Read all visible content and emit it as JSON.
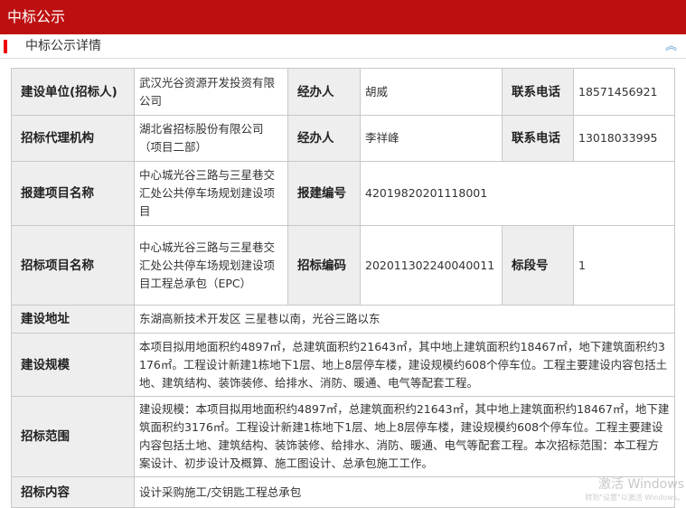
{
  "header": {
    "title": "中标公示"
  },
  "section": {
    "title": "中标公示详情",
    "collapse_icon": "double-chevron-up-icon"
  },
  "rows": {
    "r1": {
      "l1": "建设单位(招标人)",
      "v1": "武汉光谷资源开发投资有限公司",
      "l2": "经办人",
      "v2": "胡威",
      "l3": "联系电话",
      "v3": "18571456921"
    },
    "r2": {
      "l1": "招标代理机构",
      "v1": "湖北省招标股份有限公司（项目二部）",
      "l2": "经办人",
      "v2": "李祥峰",
      "l3": "联系电话",
      "v3": "13018033995"
    },
    "r3": {
      "l1": "报建项目名称",
      "v1": "中心城光谷三路与三星巷交汇处公共停车场规划建设项目",
      "l2": "报建编号",
      "v2": "42019820201118001"
    },
    "r4": {
      "l1": "招标项目名称",
      "v1": "中心城光谷三路与三星巷交汇处公共停车场规划建设项目工程总承包（EPC）",
      "l2": "招标编码",
      "v2": "202011302240040011",
      "l3": "标段号",
      "v3": "1"
    },
    "r5": {
      "l1": "建设地址",
      "v1": "东湖高新技术开发区 三星巷以南，光谷三路以东"
    },
    "r6": {
      "l1": "建设规模",
      "v1": "本项目拟用地面积约4897㎡，总建筑面积约21643㎡，其中地上建筑面积约18467㎡，地下建筑面积约3176㎡。工程设计新建1栋地下1层、地上8层停车楼，建设规模约608个停车位。工程主要建设内容包括土地、建筑结构、装饰装修、给排水、消防、暖通、电气等配套工程。"
    },
    "r7": {
      "l1": "招标范围",
      "v1": "建设规模：本项目拟用地面积约4897㎡，总建筑面积约21643㎡，其中地上建筑面积约18467㎡，地下建筑面积约3176㎡。工程设计新建1栋地下1层、地上8层停车楼，建设规模约608个停车位。工程主要建设内容包括土地、建筑结构、装饰装修、给排水、消防、暖通、电气等配套工程。本次招标范围：本工程方案设计、初步设计及概算、施工图设计、总承包施工工作。"
    },
    "r8": {
      "l1": "招标内容",
      "v1": "设计采购施工/交钥匙工程总承包"
    }
  },
  "watermark": {
    "line1": "激活 Windows",
    "line2": "转到\"设置\"以激活 Windows。"
  }
}
